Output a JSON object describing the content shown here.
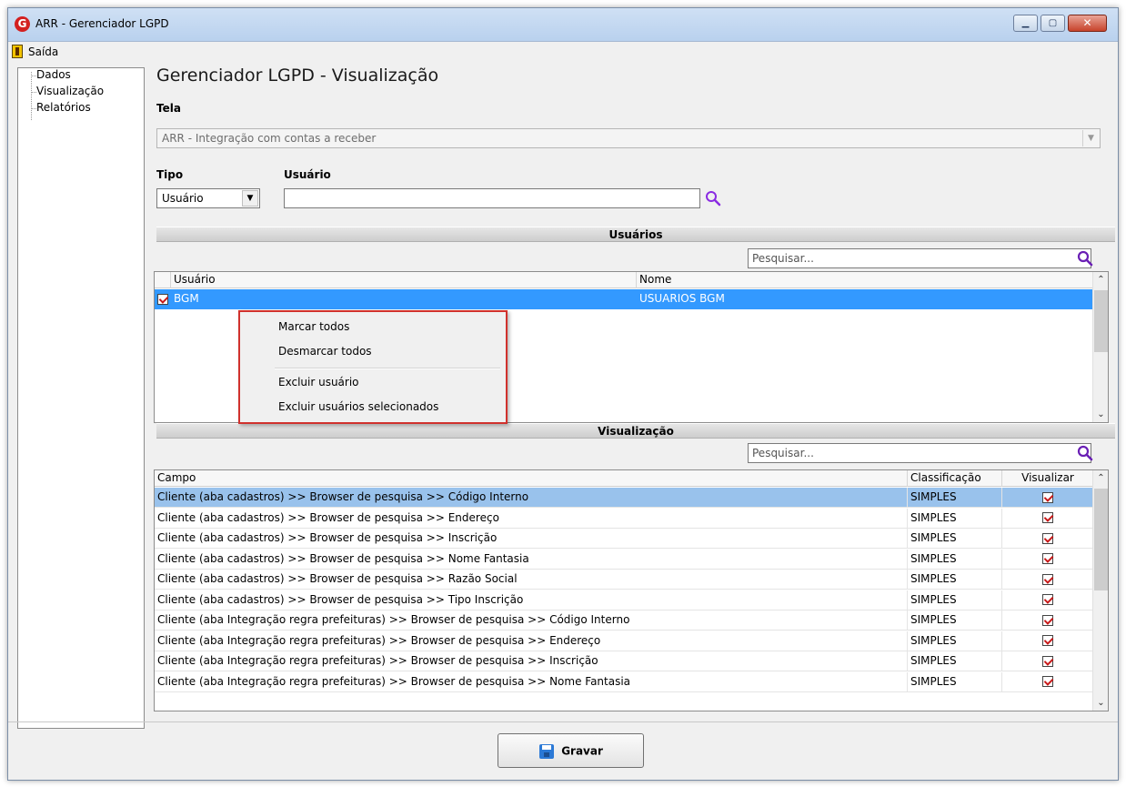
{
  "window": {
    "title": "ARR - Gerenciador LGPD",
    "app_icon_letter": "G"
  },
  "menu": {
    "exit_label": "Saída"
  },
  "nav": {
    "items": [
      {
        "label": "Dados"
      },
      {
        "label": "Visualização"
      },
      {
        "label": "Relatórios"
      }
    ]
  },
  "page": {
    "title": "Gerenciador LGPD - Visualização"
  },
  "tela": {
    "label": "Tela",
    "value": "ARR - Integração com contas a receber"
  },
  "tipo": {
    "label": "Tipo",
    "value": "Usuário"
  },
  "usuario": {
    "label": "Usuário",
    "value": ""
  },
  "users_section": {
    "title": "Usuários",
    "search_placeholder": "Pesquisar...",
    "columns": [
      "Usuário",
      "Nome"
    ],
    "rows": [
      {
        "checked": true,
        "usuario": "BGM",
        "nome": "USUARIOS BGM"
      }
    ]
  },
  "context_menu": {
    "items": [
      "Marcar todos",
      "Desmarcar todos",
      "Excluir usuário",
      "Excluir usuários selecionados"
    ]
  },
  "view_section": {
    "title": "Visualização",
    "search_placeholder": "Pesquisar...",
    "columns": [
      "Campo",
      "Classificação",
      "Visualizar"
    ],
    "rows": [
      {
        "campo": "Cliente (aba cadastros) >> Browser de pesquisa >> Código Interno",
        "classificacao": "SIMPLES",
        "visualizar": true
      },
      {
        "campo": "Cliente (aba cadastros) >> Browser de pesquisa >> Endereço",
        "classificacao": "SIMPLES",
        "visualizar": true
      },
      {
        "campo": "Cliente (aba cadastros) >> Browser de pesquisa >> Inscrição",
        "classificacao": "SIMPLES",
        "visualizar": true
      },
      {
        "campo": "Cliente (aba cadastros) >> Browser de pesquisa >> Nome Fantasia",
        "classificacao": "SIMPLES",
        "visualizar": true
      },
      {
        "campo": "Cliente (aba cadastros) >> Browser de pesquisa >> Razão Social",
        "classificacao": "SIMPLES",
        "visualizar": true
      },
      {
        "campo": "Cliente (aba cadastros) >> Browser de pesquisa >> Tipo Inscrição",
        "classificacao": "SIMPLES",
        "visualizar": true
      },
      {
        "campo": "Cliente (aba Integração regra prefeituras) >> Browser de pesquisa >> Código Interno",
        "classificacao": "SIMPLES",
        "visualizar": true
      },
      {
        "campo": "Cliente (aba Integração regra prefeituras) >> Browser de pesquisa >> Endereço",
        "classificacao": "SIMPLES",
        "visualizar": true
      },
      {
        "campo": "Cliente (aba Integração regra prefeituras) >> Browser de pesquisa >> Inscrição",
        "classificacao": "SIMPLES",
        "visualizar": true
      },
      {
        "campo": "Cliente (aba Integração regra prefeituras) >> Browser de pesquisa >> Nome Fantasia",
        "classificacao": "SIMPLES",
        "visualizar": true
      }
    ]
  },
  "footer": {
    "save_label": "Gravar"
  },
  "colors": {
    "selection": "#3399ff",
    "highlight_row": "#99c2ec",
    "context_menu_border": "#d0312d",
    "check": "#c81a1a",
    "search_icon": "#8a2be2"
  }
}
